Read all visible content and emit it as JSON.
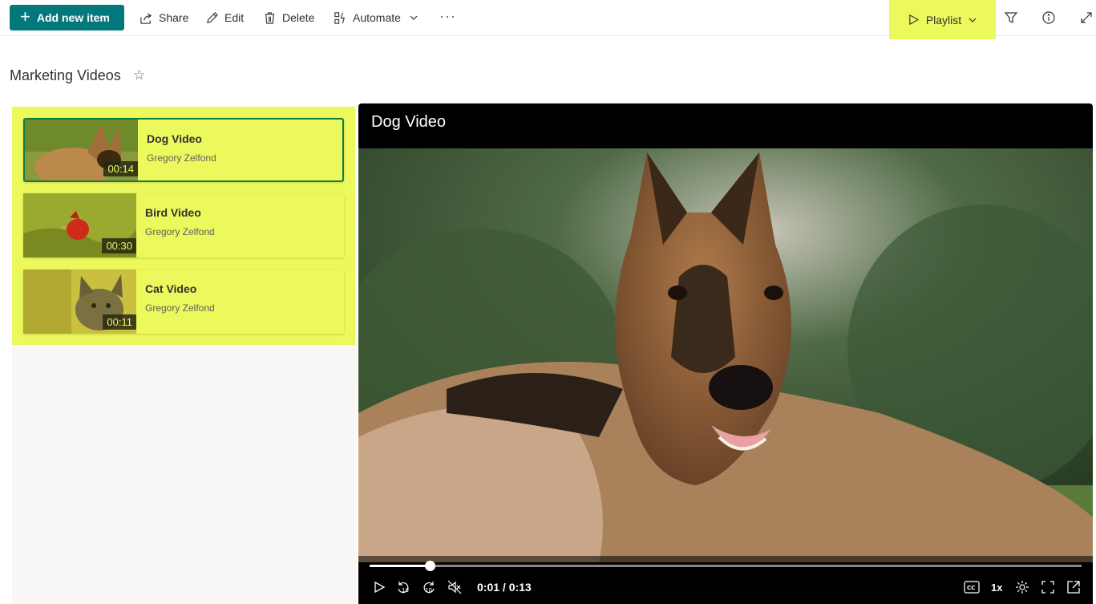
{
  "commandbar": {
    "add_label": "Add new item",
    "share_label": "Share",
    "edit_label": "Edit",
    "delete_label": "Delete",
    "automate_label": "Automate",
    "more_label": "···",
    "view_label": "Playlist",
    "highlight_color": "#ebf95c",
    "brand_color": "#03787c"
  },
  "page": {
    "title": "Marketing Videos",
    "favorite_icon": "☆"
  },
  "playlist": {
    "items": [
      {
        "title": "Dog Video",
        "author": "Gregory Zelfond",
        "duration": "00:14",
        "selected": true
      },
      {
        "title": "Bird Video",
        "author": "Gregory Zelfond",
        "duration": "00:30",
        "selected": false
      },
      {
        "title": "Cat Video",
        "author": "Gregory Zelfond",
        "duration": "00:11",
        "selected": false
      }
    ]
  },
  "player": {
    "title": "Dog Video",
    "time": "0:01 / 0:13",
    "progress_fraction": 0.085,
    "speed": "1x",
    "cc_label": "CC"
  }
}
